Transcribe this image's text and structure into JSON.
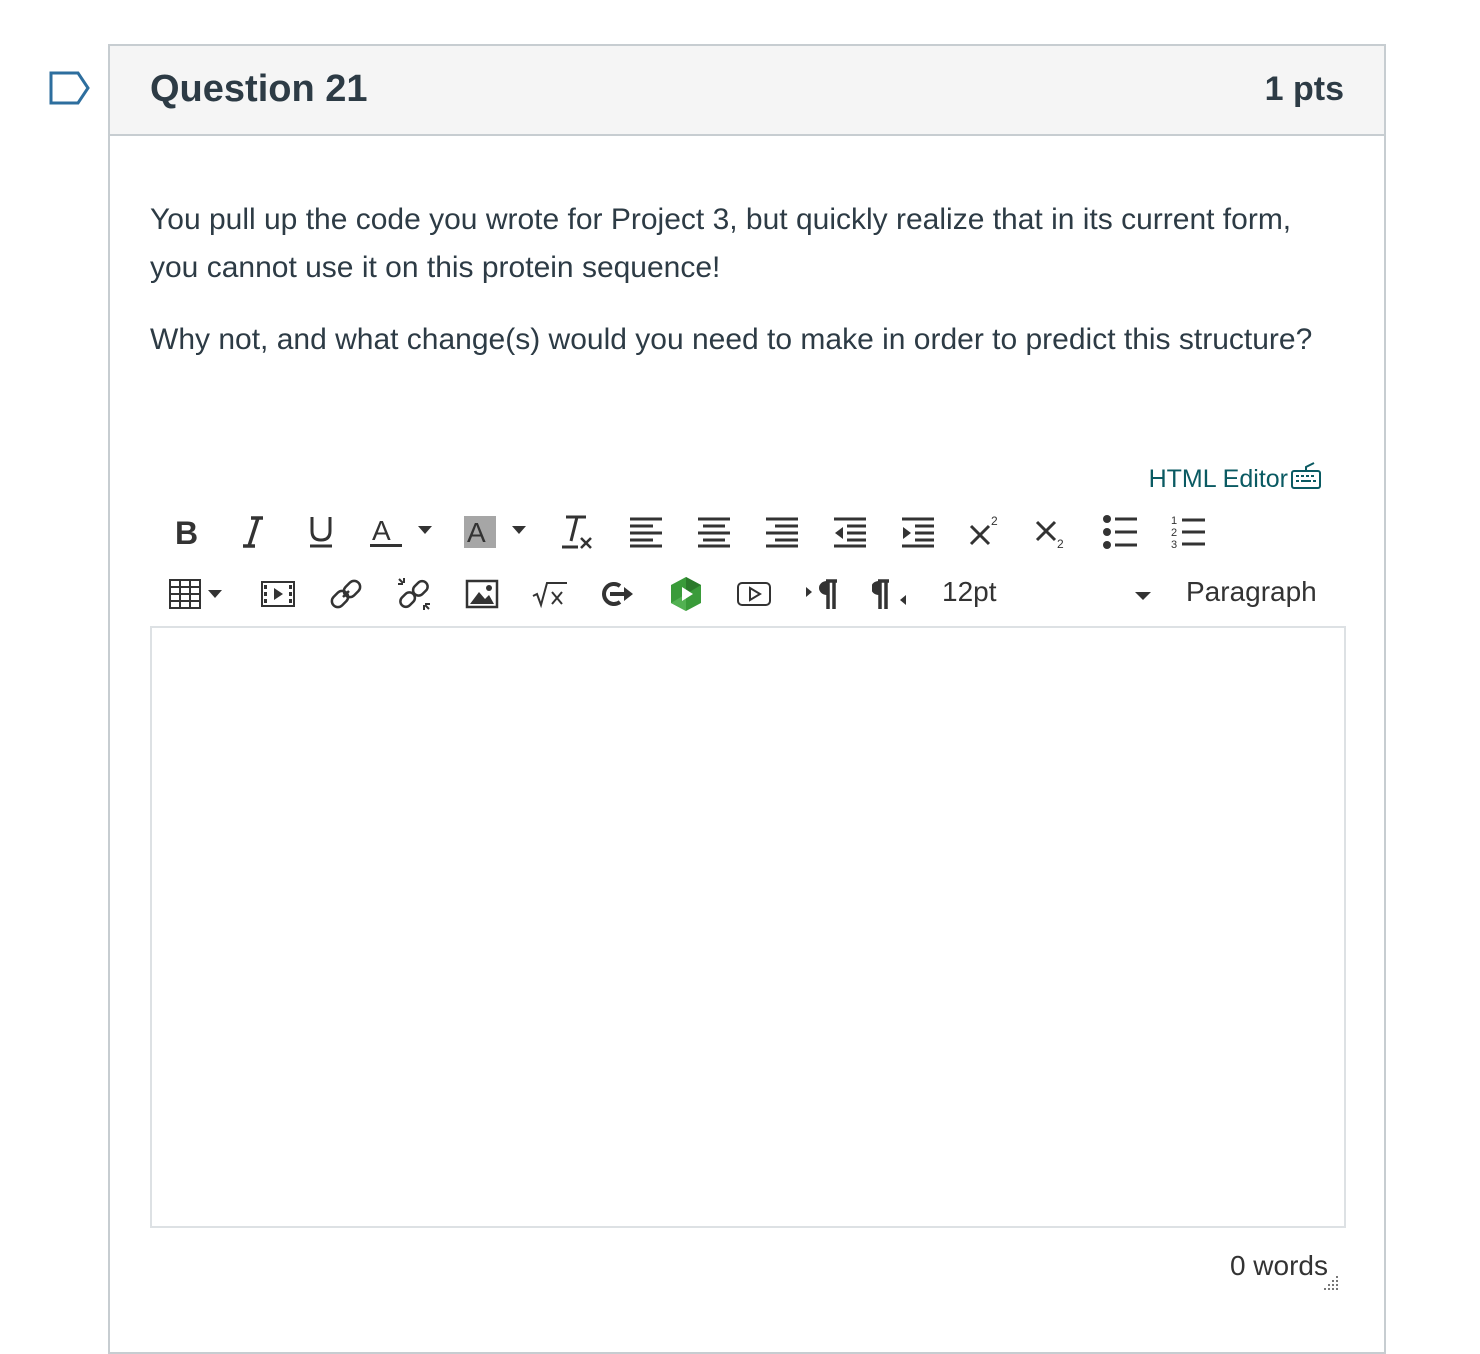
{
  "question": {
    "title": "Question 21",
    "points": "1 pts",
    "paragraphs": [
      "You pull up the code you wrote for Project 3, but quickly realize that in its current form, you cannot use it on this protein sequence!",
      "Why not, and what change(s) would you need to make in order to predict this structure?"
    ]
  },
  "editor": {
    "html_editor_label": "HTML Editor",
    "font_size": "12pt",
    "block_format": "Paragraph",
    "content": "",
    "word_count": "0 words",
    "toolbar_row1_icons": [
      "bold-icon",
      "italic-icon",
      "underline-icon",
      "text-color-icon",
      "background-color-icon",
      "clear-formatting-icon",
      "align-left-icon",
      "align-center-icon",
      "align-right-icon",
      "outdent-icon",
      "indent-icon",
      "superscript-icon",
      "subscript-icon",
      "bullet-list-icon",
      "numbered-list-icon"
    ],
    "toolbar_row2_icons": [
      "table-icon",
      "media-icon",
      "link-icon",
      "unlink-icon",
      "image-icon",
      "math-equation-icon",
      "external-tools-icon",
      "apps-icon",
      "video-icon",
      "ltr-icon",
      "rtl-icon"
    ]
  },
  "colors": {
    "header_bg": "#f5f5f5",
    "border": "#c7cdd1",
    "text": "#2d3b45",
    "link": "#0a5a62",
    "flag": "#2d6e9e"
  }
}
